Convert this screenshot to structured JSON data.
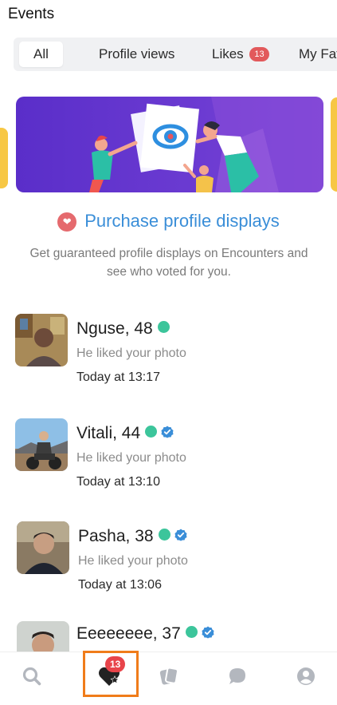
{
  "header": {
    "title": "Events"
  },
  "tabs": [
    {
      "label": "All",
      "active": true
    },
    {
      "label": "Profile views"
    },
    {
      "label": "Likes",
      "badge": "13"
    },
    {
      "label": "My Favo"
    }
  ],
  "promo": {
    "title": "Purchase profile displays",
    "description": "Get guaranteed profile displays on Encounters and see who voted for you."
  },
  "events": [
    {
      "name": "Nguse, 48",
      "online": true,
      "verified": false,
      "action": "He liked your photo",
      "time": "Today at 13:17"
    },
    {
      "name": "Vitali, 44",
      "online": true,
      "verified": true,
      "action": "He liked your photo",
      "time": "Today at 13:10"
    },
    {
      "name": "Pasha, 38",
      "online": true,
      "verified": true,
      "action": "He liked your photo",
      "time": "Today at 13:06"
    },
    {
      "name": "Eeeeeeee, 37",
      "online": true,
      "verified": true
    }
  ],
  "bottom_nav": {
    "items": [
      {
        "icon": "search-icon"
      },
      {
        "icon": "heart-star-icon",
        "badge": "13",
        "active": true
      },
      {
        "icon": "cards-icon"
      },
      {
        "icon": "chat-bubble-icon"
      },
      {
        "icon": "profile-icon"
      }
    ]
  },
  "colors": {
    "accent_blue": "#3a8ed8",
    "online_green": "#3cc59b",
    "badge_red": "#e2595b",
    "highlight_orange": "#f07c1a",
    "banner_purple": "#5a2ec9"
  }
}
